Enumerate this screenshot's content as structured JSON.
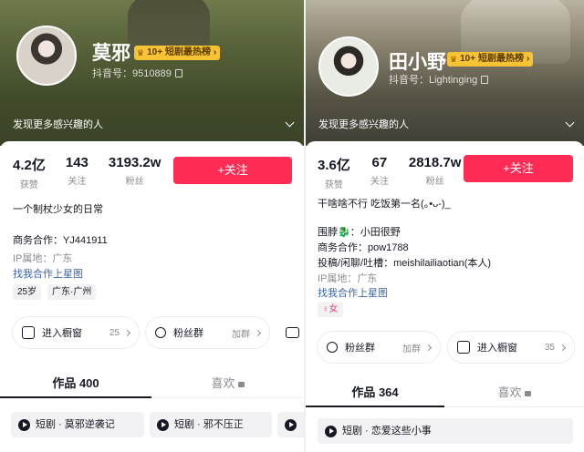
{
  "left": {
    "name": "莫邪",
    "rank_prefix": "10+",
    "rank_label": "短剧最热榜",
    "douyin_id": "抖音号：9510889",
    "discover": "发现更多感兴趣的人",
    "stats": [
      {
        "num": "4.2亿",
        "label": "获赞"
      },
      {
        "num": "143",
        "label": "关注"
      },
      {
        "num": "3193.2w",
        "label": "粉丝"
      }
    ],
    "follow": "+关注",
    "bio": "一个制杖少女的日常",
    "business": "商务合作：YJ441911",
    "ip": "IP属地：广东",
    "star_link": "找我合作上星图",
    "tags": [
      "25岁",
      "广东·广州"
    ],
    "entries": [
      {
        "label": "进入橱窗",
        "side": "25"
      },
      {
        "label": "粉丝群",
        "side": "加群"
      }
    ],
    "tabs": {
      "works": "作品 400",
      "likes": "喜欢"
    },
    "chips": [
      "短剧 · 莫邪逆袭记",
      "短剧 · 邪不压正"
    ]
  },
  "right": {
    "name": "田小野",
    "rank_prefix": "10+",
    "rank_label": "短剧最热榜",
    "douyin_id": "抖音号：Lightinging",
    "discover": "发现更多感兴趣的人",
    "stats": [
      {
        "num": "3.6亿",
        "label": "获赞"
      },
      {
        "num": "67",
        "label": "关注"
      },
      {
        "num": "2818.7w",
        "label": "粉丝"
      }
    ],
    "follow": "+关注",
    "bio": "干啥啥不行 吃饭第一名(｡•ᴗ-)_",
    "line1": "围脖🐉：小田很野",
    "business": "商务合作：pow1788",
    "contact": "投稿/闲聊/吐槽：meishilailiaotian(本人)",
    "ip": "IP属地：广东",
    "star_link": "找我合作上星图",
    "gender_tag": "♀女",
    "entries": [
      {
        "label": "粉丝群",
        "side": "加群"
      },
      {
        "label": "进入橱窗",
        "side": "35"
      }
    ],
    "tabs": {
      "works": "作品 364",
      "likes": "喜欢"
    },
    "chips": [
      "短剧 · 恋爱这些小事"
    ]
  },
  "colors": {
    "accent": "#fe2c55",
    "link": "#3b64a8",
    "badge": "#f7c234"
  }
}
